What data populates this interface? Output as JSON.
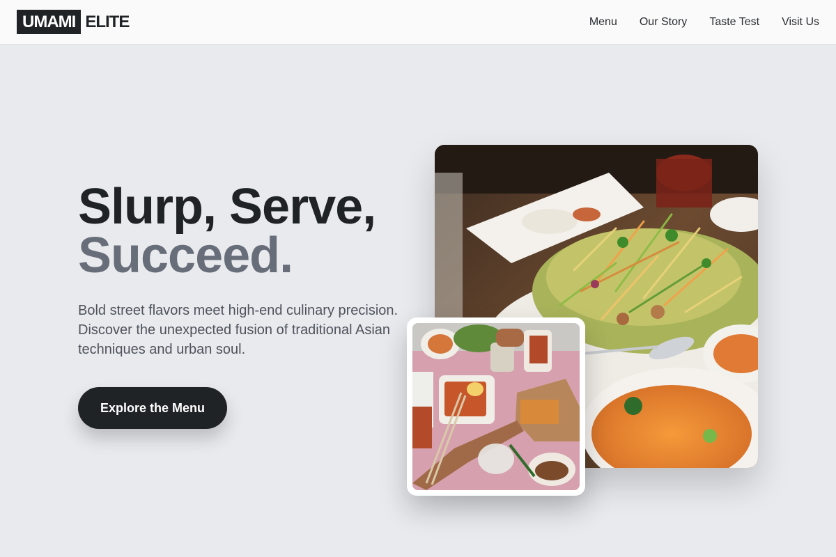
{
  "brand": {
    "logo_box_text": "UMAMI",
    "logo_rest_text": "ELITE"
  },
  "nav": {
    "items": [
      {
        "label": "Menu"
      },
      {
        "label": "Our Story"
      },
      {
        "label": "Taste Test"
      },
      {
        "label": "Visit Us"
      }
    ]
  },
  "hero": {
    "title_line_1": "Slurp, Serve,",
    "title_line_2": "Succeed.",
    "description": "Bold street flavors meet high-end culinary precision. Discover the unexpected fusion of traditional Asian techniques and urban soul.",
    "cta_label": "Explore the Menu"
  },
  "images": {
    "main_photo": "noodle-salad-dish-photo",
    "small_photo": "street-food-table-overhead-photo"
  },
  "colors": {
    "page_background": "#e9eaee",
    "header_background": "#fafafa",
    "primary_dark": "#202326",
    "title_muted": "#686e79",
    "body_text": "#4d535b",
    "cta_text": "#ffffff"
  }
}
